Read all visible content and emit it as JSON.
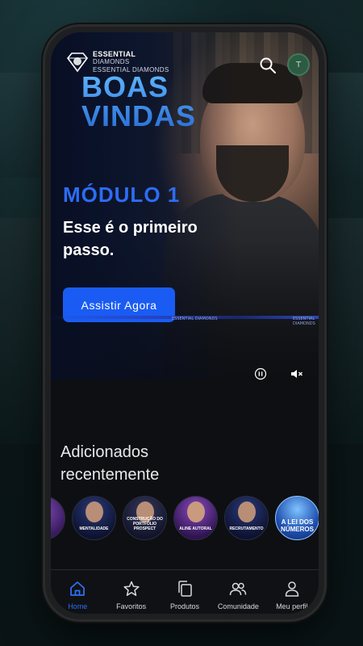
{
  "brand": {
    "name": "ESSENTIAL",
    "sub": "DIAMONDS",
    "sub2": "ESSENTIAL DIAMONDS"
  },
  "header": {
    "avatar_initial": "T"
  },
  "hero": {
    "headline_line1": "BOAS",
    "headline_line2": "VINDAS",
    "module": "MÓDULO 1",
    "tagline": "Esse é o primeiro passo.",
    "cta_label": "Assistir Agora",
    "stripe_label": "ESSENTIAL DIAMONDS"
  },
  "recent": {
    "title": "Adicionados recentemente",
    "items": [
      {
        "label": "",
        "color": "#5a2a8a"
      },
      {
        "label": "MENTALIDADE",
        "color": "#1a2a6a"
      },
      {
        "label": "CONSTRUÇÃO DO PORTFÓLIO PROSPECT",
        "color": "#20254a"
      },
      {
        "label": "ALINE AUTORAL",
        "color": "#5a2a8a"
      },
      {
        "label": "RECRUTAMENTO",
        "color": "#1a2a6a"
      },
      {
        "label": "A LEI DOS NÚMEROS",
        "color": "#1f4fb0"
      },
      {
        "label": "",
        "color": "#2a2f8a"
      }
    ]
  },
  "tabs": [
    {
      "label": "Home",
      "icon": "home-icon",
      "active": true
    },
    {
      "label": "Favoritos",
      "icon": "star-icon",
      "active": false
    },
    {
      "label": "Produtos",
      "icon": "copy-icon",
      "active": false
    },
    {
      "label": "Comunidade",
      "icon": "users-icon",
      "active": false
    },
    {
      "label": "Meu perfil",
      "icon": "user-icon",
      "active": false
    }
  ],
  "colors": {
    "accent": "#1a5cf3",
    "tab_active": "#2f6ef5",
    "background": "#0e0f12"
  }
}
